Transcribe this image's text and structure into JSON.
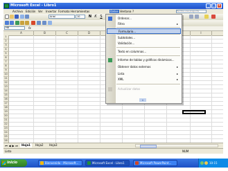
{
  "window": {
    "title": "Microsoft Excel - Libro1",
    "controls": [
      "_",
      "□",
      "x"
    ]
  },
  "menubar": {
    "items": [
      "Archivo",
      "Edición",
      "Ver",
      "Insertar",
      "Formato",
      "Herramientas",
      "Datos",
      "Ventana",
      "?"
    ],
    "active_index": 6,
    "help_placeholder": "Escriba una pregunta"
  },
  "toolbar": {
    "font_name": "Arial",
    "font_size": "10",
    "bold": "N",
    "italic": "K",
    "underline": "S"
  },
  "formula_bar": {
    "name_box": "H8",
    "fx": "fx"
  },
  "grid": {
    "columns": [
      "A",
      "B",
      "C",
      "D",
      "E",
      "F",
      "G",
      "H",
      "I"
    ],
    "rows": [
      "1",
      "2",
      "3",
      "4",
      "5",
      "6",
      "7",
      "8",
      "9",
      "10",
      "11",
      "12",
      "13",
      "14",
      "15",
      "16",
      "17",
      "18",
      "19",
      "20",
      "21",
      "22",
      "23",
      "24",
      "25",
      "26"
    ],
    "selected_cell": "H8"
  },
  "datos_menu": {
    "items": [
      {
        "label": "Ordenar...",
        "icon": "sort-icon",
        "submenu": false
      },
      {
        "label": "Filtro",
        "icon": "",
        "submenu": true
      },
      {
        "label": "Formulario...",
        "icon": "",
        "submenu": false,
        "highlighted": true
      },
      {
        "label": "Subtotales...",
        "icon": "",
        "submenu": false
      },
      {
        "label": "Validación...",
        "icon": "",
        "submenu": false
      },
      {
        "label": "Texto en columnas...",
        "icon": "",
        "submenu": false
      },
      {
        "label": "Informe de tablas y gráficos dinámicos...",
        "icon": "pivot-table-icon",
        "submenu": false
      },
      {
        "label": "Obtener datos externos",
        "icon": "",
        "submenu": true
      },
      {
        "label": "Lista",
        "icon": "",
        "submenu": true
      },
      {
        "label": "XML",
        "icon": "",
        "submenu": true
      },
      {
        "label": "Actualizar datos",
        "icon": "refresh-icon",
        "submenu": false,
        "disabled": true
      }
    ],
    "expand_glyph": "»"
  },
  "sheet_tabs": {
    "tabs": [
      "Hoja1",
      "Hoja2",
      "Hoja3"
    ],
    "active_index": 0
  },
  "statusbar": {
    "text": "Listo",
    "mode": "NUM"
  },
  "taskbar": {
    "start_label": "inicio",
    "buttons": [
      {
        "label": "Bienvenido - Microsoft...",
        "color": "#f2b705"
      },
      {
        "label": "Microsoft Excel - Libro1",
        "color": "#1e8f3a"
      },
      {
        "label": "Microsoft PowerPoint...",
        "color": "#d24726"
      }
    ],
    "clock": "10:15"
  },
  "colors": {
    "titlebar": "#1c4fcb",
    "menu_highlight": "#316ac5",
    "taskbar": "#2458d0",
    "start_button": "#3a8f2c"
  }
}
